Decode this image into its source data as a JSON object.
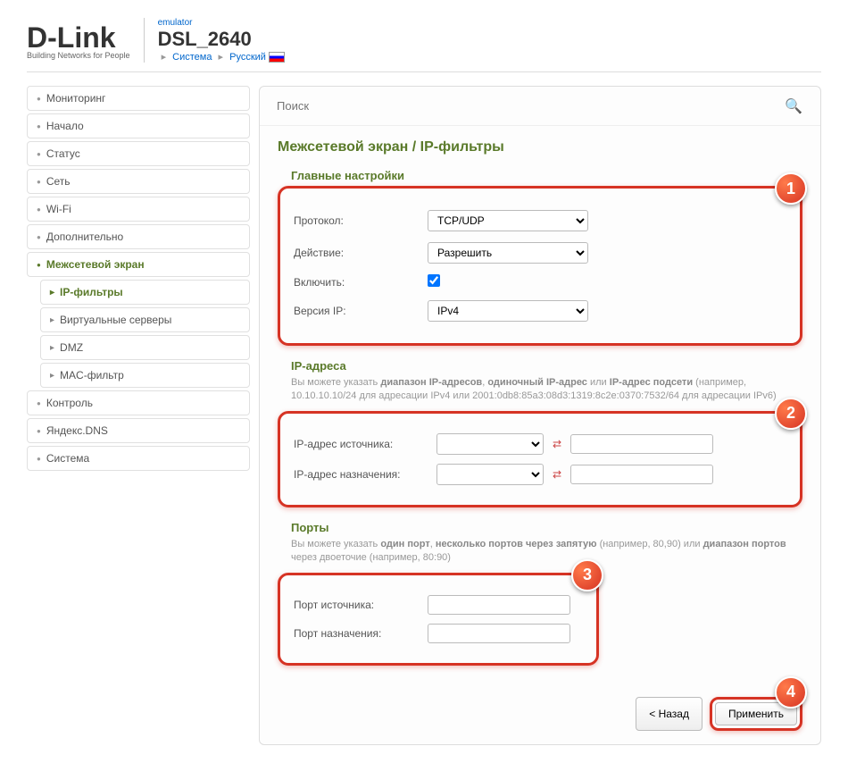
{
  "header": {
    "brand": "D-Link",
    "brand_sub": "Building Networks for People",
    "emulator": "emulator",
    "model": "DSL_2640",
    "bc_system": "Система",
    "bc_lang": "Русский"
  },
  "sidebar": {
    "items": [
      {
        "label": "Мониторинг"
      },
      {
        "label": "Начало"
      },
      {
        "label": "Статус"
      },
      {
        "label": "Сеть"
      },
      {
        "label": "Wi-Fi"
      },
      {
        "label": "Дополнительно"
      },
      {
        "label": "Межсетевой экран",
        "active": true
      },
      {
        "label": "IP-фильтры",
        "sub": true,
        "active": true
      },
      {
        "label": "Виртуальные серверы",
        "sub": true
      },
      {
        "label": "DMZ",
        "sub": true
      },
      {
        "label": "MAC-фильтр",
        "sub": true
      },
      {
        "label": "Контроль"
      },
      {
        "label": "Яндекс.DNS"
      },
      {
        "label": "Система"
      }
    ]
  },
  "search": {
    "placeholder": "Поиск"
  },
  "page": {
    "title": "Межсетевой экран / IP-фильтры",
    "section1_title": "Главные настройки",
    "protocol_label": "Протокол:",
    "protocol_value": "TCP/UDP",
    "action_label": "Действие:",
    "action_value": "Разрешить",
    "enable_label": "Включить:",
    "enable_checked": true,
    "ipver_label": "Версия IP:",
    "ipver_value": "IPv4",
    "section2_title": "IP-адреса",
    "section2_desc_a": "Вы можете указать ",
    "section2_desc_b1": "диапазон IP-адресов",
    "section2_desc_c": ", ",
    "section2_desc_b2": "одиночный IP-адрес",
    "section2_desc_d": " или ",
    "section2_desc_b3": "IP-адрес подсети",
    "section2_desc_e": " (например, 10.10.10.10/24 для адресации IPv4 или 2001:0db8:85a3:08d3:1319:8c2e:0370:7532/64 для адресации IPv6)",
    "ip_src_label": "IP-адрес источника:",
    "ip_dst_label": "IP-адрес назначения:",
    "section3_title": "Порты",
    "section3_desc_a": "Вы можете указать ",
    "section3_desc_b1": "один порт",
    "section3_desc_c": ", ",
    "section3_desc_b2": "несколько портов через запятую",
    "section3_desc_d": " (например, 80,90) или ",
    "section3_desc_b3": "диапазон портов",
    "section3_desc_e": " через двоеточие (например, 80:90)",
    "port_src_label": "Порт источника:",
    "port_dst_label": "Порт назначения:",
    "back_btn": "< Назад",
    "apply_btn": "Применить"
  },
  "callouts": {
    "c1": "1",
    "c2": "2",
    "c3": "3",
    "c4": "4"
  }
}
